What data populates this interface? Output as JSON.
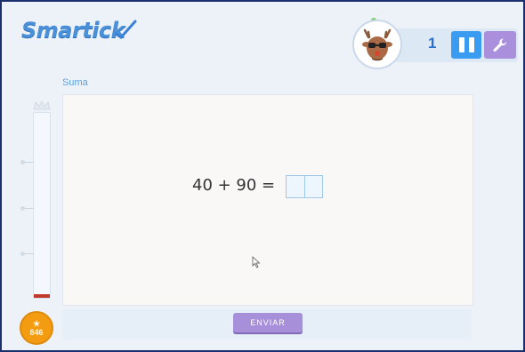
{
  "app": {
    "logo_text": "Smartick"
  },
  "header": {
    "level": "1",
    "pause_icon": "pause-icon",
    "settings_icon": "wrench-icon",
    "avatar_icon": "reindeer-avatar"
  },
  "exercise": {
    "subject": "Suma",
    "equation": "40 + 90 =",
    "answer_cells": [
      "",
      ""
    ]
  },
  "progress": {
    "level_fraction": 0.02
  },
  "actions": {
    "send_label": "ENVIAR"
  },
  "score": {
    "stars": "846"
  },
  "colors": {
    "frame": "#1a2f6e",
    "accent_blue": "#3a9cf0",
    "accent_purple": "#a88fd9",
    "coin": "#f39c12",
    "progress_fill": "#c0392b"
  }
}
